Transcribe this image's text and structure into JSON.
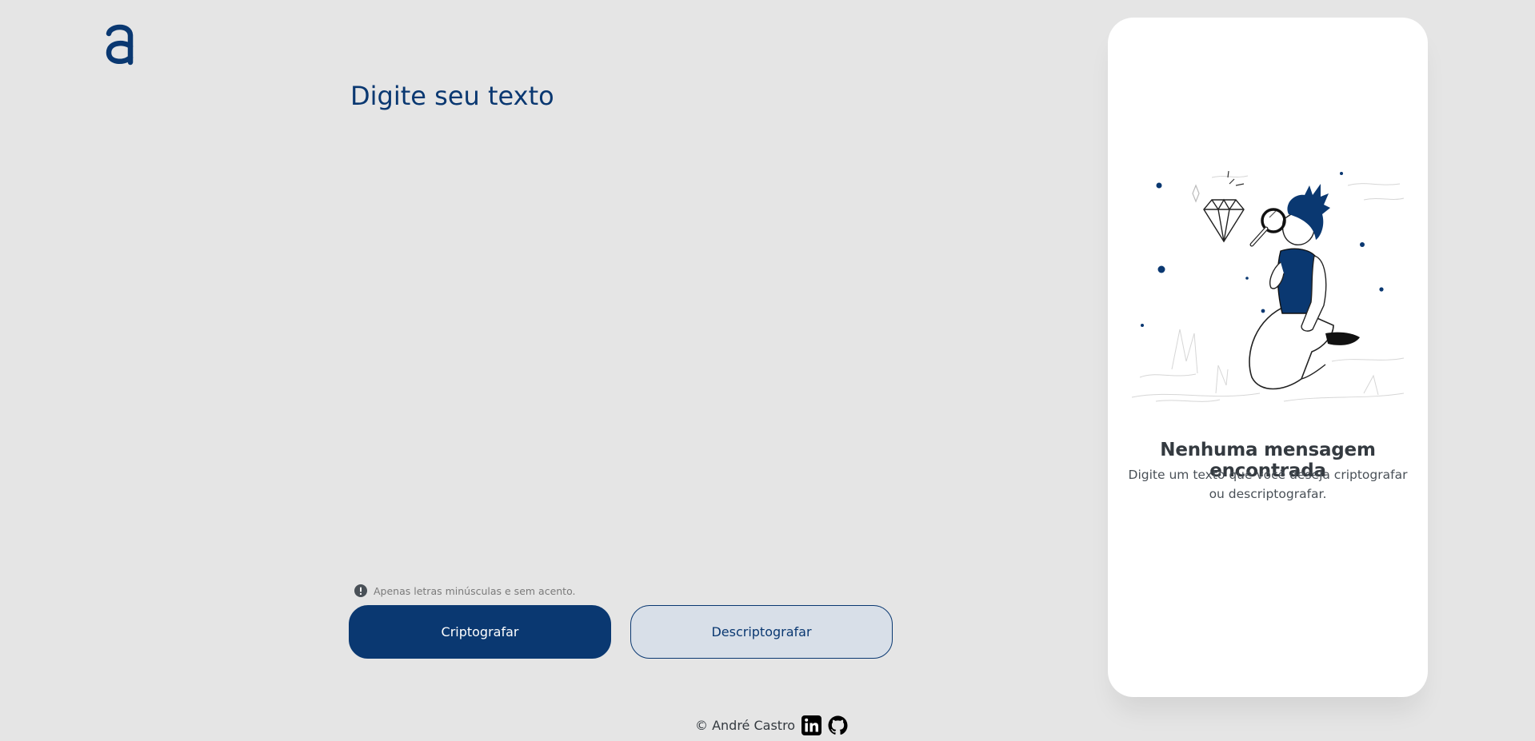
{
  "brand": {
    "logo_icon": "alura-a-logo-icon",
    "color": "#0a3871"
  },
  "editor": {
    "placeholder": "Digite seu texto",
    "value": ""
  },
  "hint": {
    "icon": "exclamation-circle-icon",
    "text": "Apenas letras minúsculas e sem acento."
  },
  "actions": {
    "encrypt_label": "Criptografar",
    "decrypt_label": "Descriptografar"
  },
  "output_panel": {
    "illustration": "person-with-magnifier-and-diamond-illustration",
    "title": "Nenhuma mensagem encontrada",
    "description": "Digite um texto que você deseja criptografar ou descriptografar."
  },
  "footer": {
    "credit": "© André Castro",
    "links": [
      {
        "icon": "linkedin-icon"
      },
      {
        "icon": "github-icon"
      }
    ]
  },
  "colors": {
    "background": "#e5e5e5",
    "primary": "#0a3871",
    "secondary_bg": "#d8dfe8",
    "panel_bg": "#ffffff",
    "text_dark": "#343a40"
  }
}
